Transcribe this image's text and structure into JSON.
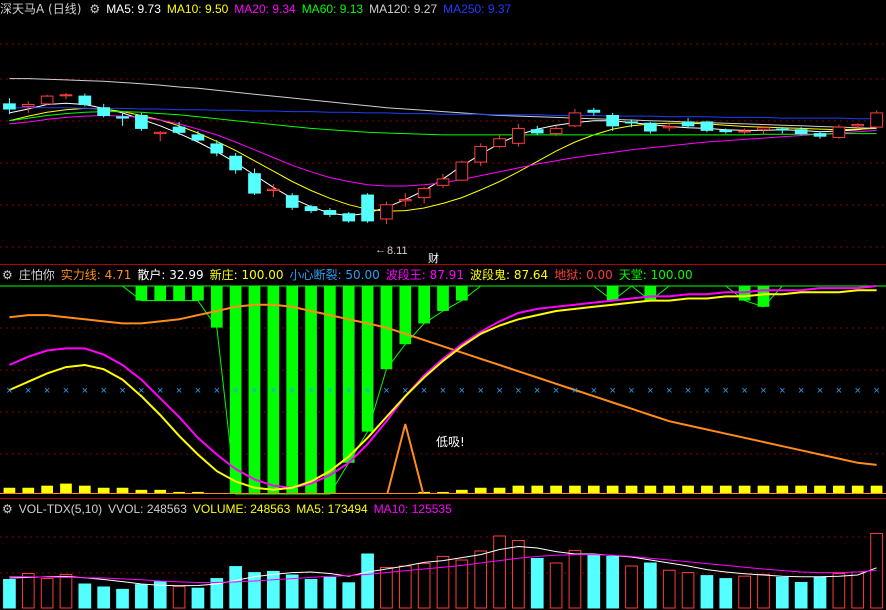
{
  "colors": {
    "bg": "#000000",
    "grid": "#8b0000",
    "up": "#ff3b3b",
    "down": "#54ffff",
    "ma5": "#ffffff",
    "ma10": "#ffff00",
    "ma20": "#ff00ff",
    "ma60": "#00ff00",
    "ma120": "#cfcfcf",
    "ma250": "#1f3cff",
    "orange": "#ff8c1a",
    "green": "#00ff00",
    "dodger": "#2a9df4"
  },
  "panel1": {
    "stock": "深天马A",
    "period": "(日线)",
    "items": [
      {
        "label": "MA5:",
        "value": "9.73",
        "color": "#ffffff"
      },
      {
        "label": "MA10:",
        "value": "9.50",
        "color": "#ffff00"
      },
      {
        "label": "MA20:",
        "value": "9.34",
        "color": "#ff00ff"
      },
      {
        "label": "MA60:",
        "value": "9.13",
        "color": "#00ff00"
      },
      {
        "label": "MA120:",
        "value": "9.27",
        "color": "#cfcfcf"
      },
      {
        "label": "MA250:",
        "value": "9.37",
        "color": "#1f3cff"
      }
    ],
    "low_label": "8.11",
    "finance_mark": "财"
  },
  "panel2": {
    "title": "庄怕你",
    "items": [
      {
        "label": "实力线:",
        "value": "4.71",
        "color": "#ff8c1a"
      },
      {
        "label": "散户:",
        "value": "32.99",
        "color": "#ffffff"
      },
      {
        "label": "新庄:",
        "value": "100.00",
        "color": "#ffff00"
      },
      {
        "label": "小心断裂:",
        "value": "50.00",
        "color": "#2a9df4"
      },
      {
        "label": "波段王:",
        "value": "87.91",
        "color": "#ff00ff"
      },
      {
        "label": "波段鬼:",
        "value": "87.64",
        "color": "#ffff00"
      },
      {
        "label": "地狱:",
        "value": "0.00",
        "color": "#ff3b3b"
      },
      {
        "label": "天堂:",
        "value": "100.00",
        "color": "#00ff00"
      }
    ],
    "signal_label": "低吸!"
  },
  "panel3": {
    "title": "VOL-TDX(5,10)",
    "items": [
      {
        "label": "VVOL:",
        "value": "248563",
        "color": "#cfcfcf"
      },
      {
        "label": "VOLUME:",
        "value": "248563",
        "color": "#ffff00"
      },
      {
        "label": "MA5:",
        "value": "173494",
        "color": "#ffff00"
      },
      {
        "label": "MA10:",
        "value": "125535",
        "color": "#ff00ff"
      }
    ]
  },
  "chart_data": [
    {
      "type": "candlestick",
      "ylim": [
        7.6,
        10.6
      ],
      "candles": [
        {
          "o": 9.86,
          "h": 9.95,
          "l": 9.7,
          "c": 9.78
        },
        {
          "o": 9.82,
          "h": 9.9,
          "l": 9.72,
          "c": 9.85
        },
        {
          "o": 9.86,
          "h": 10.0,
          "l": 9.84,
          "c": 9.98
        },
        {
          "o": 9.99,
          "h": 10.03,
          "l": 9.93,
          "c": 10.0
        },
        {
          "o": 9.98,
          "h": 10.02,
          "l": 9.82,
          "c": 9.85
        },
        {
          "o": 9.8,
          "h": 9.86,
          "l": 9.65,
          "c": 9.68
        },
        {
          "o": 9.66,
          "h": 9.72,
          "l": 9.52,
          "c": 9.64
        },
        {
          "o": 9.68,
          "h": 9.72,
          "l": 9.44,
          "c": 9.48
        },
        {
          "o": 9.4,
          "h": 9.44,
          "l": 9.28,
          "c": 9.42
        },
        {
          "o": 9.5,
          "h": 9.58,
          "l": 9.38,
          "c": 9.42
        },
        {
          "o": 9.38,
          "h": 9.44,
          "l": 9.27,
          "c": 9.3
        },
        {
          "o": 9.24,
          "h": 9.3,
          "l": 9.05,
          "c": 9.1
        },
        {
          "o": 9.05,
          "h": 9.1,
          "l": 8.78,
          "c": 8.84
        },
        {
          "o": 8.78,
          "h": 8.86,
          "l": 8.45,
          "c": 8.48
        },
        {
          "o": 8.52,
          "h": 8.62,
          "l": 8.42,
          "c": 8.54
        },
        {
          "o": 8.44,
          "h": 8.48,
          "l": 8.22,
          "c": 8.26
        },
        {
          "o": 8.27,
          "h": 8.3,
          "l": 8.17,
          "c": 8.21
        },
        {
          "o": 8.21,
          "h": 8.25,
          "l": 8.11,
          "c": 8.15
        },
        {
          "o": 8.16,
          "h": 8.19,
          "l": 8.02,
          "c": 8.05
        },
        {
          "o": 8.45,
          "h": 8.48,
          "l": 8.02,
          "c": 8.05
        },
        {
          "o": 8.08,
          "h": 8.35,
          "l": 8.0,
          "c": 8.3
        },
        {
          "o": 8.36,
          "h": 8.48,
          "l": 8.27,
          "c": 8.38
        },
        {
          "o": 8.41,
          "h": 8.58,
          "l": 8.32,
          "c": 8.55
        },
        {
          "o": 8.6,
          "h": 8.78,
          "l": 8.56,
          "c": 8.7
        },
        {
          "o": 8.68,
          "h": 8.98,
          "l": 8.68,
          "c": 8.96
        },
        {
          "o": 8.96,
          "h": 9.25,
          "l": 8.9,
          "c": 9.2
        },
        {
          "o": 9.2,
          "h": 9.38,
          "l": 9.18,
          "c": 9.32
        },
        {
          "o": 9.25,
          "h": 9.55,
          "l": 9.2,
          "c": 9.48
        },
        {
          "o": 9.46,
          "h": 9.52,
          "l": 9.38,
          "c": 9.41
        },
        {
          "o": 9.4,
          "h": 9.52,
          "l": 9.36,
          "c": 9.48
        },
        {
          "o": 9.52,
          "h": 9.78,
          "l": 9.5,
          "c": 9.72
        },
        {
          "o": 9.76,
          "h": 9.8,
          "l": 9.68,
          "c": 9.73
        },
        {
          "o": 9.68,
          "h": 9.72,
          "l": 9.44,
          "c": 9.52
        },
        {
          "o": 9.58,
          "h": 9.62,
          "l": 9.5,
          "c": 9.57
        },
        {
          "o": 9.56,
          "h": 9.58,
          "l": 9.4,
          "c": 9.44
        },
        {
          "o": 9.49,
          "h": 9.56,
          "l": 9.44,
          "c": 9.51
        },
        {
          "o": 9.58,
          "h": 9.64,
          "l": 9.48,
          "c": 9.52
        },
        {
          "o": 9.58,
          "h": 9.6,
          "l": 9.42,
          "c": 9.45
        },
        {
          "o": 9.45,
          "h": 9.48,
          "l": 9.4,
          "c": 9.43
        },
        {
          "o": 9.43,
          "h": 9.48,
          "l": 9.39,
          "c": 9.44
        },
        {
          "o": 9.46,
          "h": 9.5,
          "l": 9.4,
          "c": 9.49
        },
        {
          "o": 9.47,
          "h": 9.5,
          "l": 9.4,
          "c": 9.46
        },
        {
          "o": 9.46,
          "h": 9.5,
          "l": 9.38,
          "c": 9.4
        },
        {
          "o": 9.4,
          "h": 9.44,
          "l": 9.32,
          "c": 9.36
        },
        {
          "o": 9.34,
          "h": 9.54,
          "l": 9.32,
          "c": 9.5
        },
        {
          "o": 9.52,
          "h": 9.56,
          "l": 9.48,
          "c": 9.54
        },
        {
          "o": 9.5,
          "h": 9.76,
          "l": 9.48,
          "c": 9.72
        }
      ],
      "ma": {
        "MA5": [
          9.72,
          9.78,
          9.85,
          9.87,
          9.85,
          9.79,
          9.72,
          9.62,
          9.52,
          9.4,
          9.27,
          9.12,
          8.95,
          8.76,
          8.57,
          8.4,
          8.27,
          8.17,
          8.13,
          8.17,
          8.26,
          8.38,
          8.52,
          8.7,
          8.9,
          9.08,
          9.25,
          9.38,
          9.47,
          9.53,
          9.57,
          9.6,
          9.6,
          9.57,
          9.54,
          9.51,
          9.49,
          9.48,
          9.46,
          9.45,
          9.45,
          9.46,
          9.45,
          9.43,
          9.44,
          9.46,
          9.5
        ],
        "MA10": [
          9.6,
          9.67,
          9.73,
          9.77,
          9.79,
          9.78,
          9.74,
          9.68,
          9.61,
          9.52,
          9.41,
          9.28,
          9.14,
          8.98,
          8.82,
          8.66,
          8.52,
          8.4,
          8.3,
          8.23,
          8.2,
          8.21,
          8.25,
          8.32,
          8.41,
          8.53,
          8.66,
          8.81,
          8.97,
          9.13,
          9.27,
          9.38,
          9.47,
          9.52,
          9.55,
          9.56,
          9.56,
          9.55,
          9.53,
          9.51,
          9.5,
          9.49,
          9.48,
          9.47,
          9.46,
          9.47,
          9.48
        ],
        "MA20": [
          9.55,
          9.58,
          9.62,
          9.65,
          9.67,
          9.68,
          9.67,
          9.65,
          9.61,
          9.55,
          9.47,
          9.38,
          9.27,
          9.15,
          9.03,
          8.91,
          8.81,
          8.72,
          8.66,
          8.61,
          8.59,
          8.59,
          8.61,
          8.64,
          8.69,
          8.75,
          8.81,
          8.87,
          8.93,
          8.98,
          9.03,
          9.07,
          9.11,
          9.15,
          9.18,
          9.21,
          9.24,
          9.27,
          9.29,
          9.31,
          9.33,
          9.35,
          9.37,
          9.39,
          9.41,
          9.43,
          9.45
        ],
        "MA60": [
          9.6,
          9.64,
          9.68,
          9.71,
          9.73,
          9.74,
          9.74,
          9.73,
          9.71,
          9.69,
          9.66,
          9.63,
          9.6,
          9.57,
          9.54,
          9.51,
          9.48,
          9.46,
          9.44,
          9.42,
          9.41,
          9.4,
          9.39,
          9.38,
          9.38,
          9.38,
          9.38,
          9.38,
          9.38,
          9.38,
          9.38,
          9.38,
          9.38,
          9.38,
          9.38,
          9.38,
          9.38,
          9.38,
          9.38,
          9.38,
          9.39,
          9.39,
          9.39,
          9.39,
          9.4,
          9.4,
          9.4
        ],
        "MA120": [
          10.25,
          10.25,
          10.24,
          10.23,
          10.22,
          10.21,
          10.19,
          10.17,
          10.15,
          10.12,
          10.1,
          10.07,
          10.04,
          10.01,
          9.98,
          9.95,
          9.92,
          9.89,
          9.86,
          9.83,
          9.8,
          9.78,
          9.76,
          9.74,
          9.72,
          9.7,
          9.68,
          9.67,
          9.66,
          9.65,
          9.64,
          9.63,
          9.62,
          9.61,
          9.6,
          9.59,
          9.58,
          9.57,
          9.56,
          9.55,
          9.54,
          9.53,
          9.52,
          9.51,
          9.5,
          9.49,
          9.48
        ],
        "MA250": [
          9.8,
          9.8,
          9.8,
          9.8,
          9.79,
          9.79,
          9.79,
          9.78,
          9.78,
          9.77,
          9.77,
          9.76,
          9.76,
          9.75,
          9.75,
          9.74,
          9.74,
          9.73,
          9.73,
          9.72,
          9.72,
          9.71,
          9.71,
          9.7,
          9.7,
          9.7,
          9.69,
          9.69,
          9.69,
          9.68,
          9.68,
          9.68,
          9.67,
          9.67,
          9.67,
          9.66,
          9.66,
          9.66,
          9.65,
          9.65,
          9.65,
          9.64,
          9.64,
          9.64,
          9.64,
          9.63,
          9.63
        ]
      }
    },
    {
      "type": "indicator",
      "ylim": [
        0,
        100
      ],
      "green_bars_top": [
        100,
        100,
        100,
        100,
        100,
        100,
        100,
        100,
        100,
        100,
        100,
        100,
        100,
        100,
        100,
        100,
        100,
        100,
        100,
        100,
        100,
        100,
        100,
        100,
        100,
        100,
        100,
        100,
        100,
        100,
        100,
        100,
        100,
        100,
        100,
        100,
        100,
        100,
        100,
        100,
        100,
        100,
        100,
        100,
        100,
        100,
        100
      ],
      "green_bars_bottom": [
        100,
        100,
        100,
        100,
        100,
        100,
        100,
        93,
        93,
        93,
        93,
        80,
        0,
        0,
        0,
        0,
        0,
        0,
        15,
        30,
        60,
        72,
        82,
        88,
        93,
        100,
        100,
        100,
        100,
        100,
        100,
        100,
        93,
        100,
        93,
        100,
        100,
        100,
        100,
        93,
        90,
        100,
        100,
        100,
        100,
        100,
        100
      ],
      "magenta": [
        62,
        66,
        69,
        70,
        70,
        67,
        62,
        55,
        46,
        37,
        27,
        19,
        12,
        7,
        4,
        3,
        5,
        9,
        15,
        24,
        35,
        47,
        57,
        65,
        72,
        78,
        83,
        87,
        89,
        90,
        91,
        92,
        93,
        94,
        95,
        95,
        96,
        96,
        97,
        97,
        98,
        98,
        98,
        99,
        99,
        99,
        100
      ],
      "yellow": [
        50,
        54,
        58,
        61,
        62,
        60,
        55,
        47,
        38,
        28,
        19,
        11,
        6,
        3,
        2,
        3,
        6,
        11,
        18,
        27,
        37,
        47,
        56,
        64,
        71,
        77,
        81,
        84,
        86,
        88,
        89,
        90,
        91,
        92,
        93,
        93,
        94,
        94,
        95,
        95,
        96,
        96,
        97,
        97,
        97,
        98,
        98
      ],
      "orange": [
        85,
        86,
        86,
        85,
        84,
        83,
        82,
        82,
        83,
        84,
        86,
        88,
        90,
        91,
        91,
        90,
        88,
        86,
        84,
        82,
        80,
        77,
        74,
        71,
        68,
        65,
        62,
        59,
        56,
        53,
        50,
        47,
        44,
        41,
        38,
        35,
        33,
        31,
        29,
        27,
        25,
        23,
        21,
        19,
        17,
        15,
        14
      ],
      "blue_markers": 50,
      "signal_index": 21,
      "bottom_bars": [
        3,
        3,
        4,
        5,
        4,
        3,
        3,
        2,
        2,
        1,
        1,
        0,
        0,
        0,
        0,
        0,
        0,
        0,
        0,
        0,
        0,
        0,
        1,
        1,
        2,
        3,
        3,
        4,
        4,
        4,
        4,
        4,
        4,
        4,
        4,
        4,
        4,
        4,
        4,
        4,
        4,
        4,
        4,
        4,
        4,
        4,
        4
      ]
    },
    {
      "type": "bar",
      "ylim": [
        0,
        300000
      ],
      "volume": [
        95000,
        115000,
        98000,
        112000,
        80000,
        70000,
        62000,
        78000,
        88000,
        72000,
        66000,
        98000,
        138000,
        118000,
        122000,
        110000,
        95000,
        102000,
        84000,
        180000,
        135000,
        140000,
        148000,
        172000,
        160000,
        190000,
        240000,
        225000,
        165000,
        150000,
        192000,
        178000,
        172000,
        140000,
        150000,
        126000,
        118000,
        108000,
        98000,
        106000,
        112000,
        102000,
        85000,
        102000,
        115000,
        120000,
        248563
      ],
      "up": [
        false,
        true,
        true,
        true,
        false,
        false,
        false,
        false,
        false,
        true,
        false,
        false,
        false,
        false,
        false,
        false,
        false,
        false,
        false,
        false,
        true,
        true,
        true,
        true,
        true,
        true,
        true,
        true,
        false,
        true,
        true,
        false,
        false,
        true,
        false,
        true,
        true,
        false,
        false,
        true,
        true,
        false,
        false,
        false,
        true,
        true,
        true
      ],
      "ma5": [
        100000,
        102000,
        104000,
        105000,
        101000,
        95000,
        88000,
        80000,
        76000,
        74000,
        75000,
        80000,
        92000,
        104000,
        112000,
        118000,
        120000,
        115000,
        106000,
        120000,
        130000,
        140000,
        152000,
        158000,
        168000,
        178000,
        195000,
        205000,
        200000,
        188000,
        180000,
        180000,
        175000,
        170000,
        160000,
        150000,
        140000,
        128000,
        120000,
        114000,
        110000,
        106000,
        104000,
        104000,
        106000,
        110000,
        134000
      ],
      "ma10": [
        105000,
        104000,
        103000,
        102000,
        101000,
        100000,
        97000,
        94000,
        90000,
        87000,
        85000,
        85000,
        87000,
        90000,
        94000,
        98000,
        102000,
        106000,
        108000,
        112000,
        118000,
        124000,
        130000,
        136000,
        142000,
        150000,
        158000,
        166000,
        172000,
        176000,
        178000,
        178000,
        176000,
        172000,
        166000,
        160000,
        154000,
        148000,
        142000,
        136000,
        130000,
        125000,
        120000,
        118000,
        118000,
        120000,
        125535
      ]
    }
  ]
}
